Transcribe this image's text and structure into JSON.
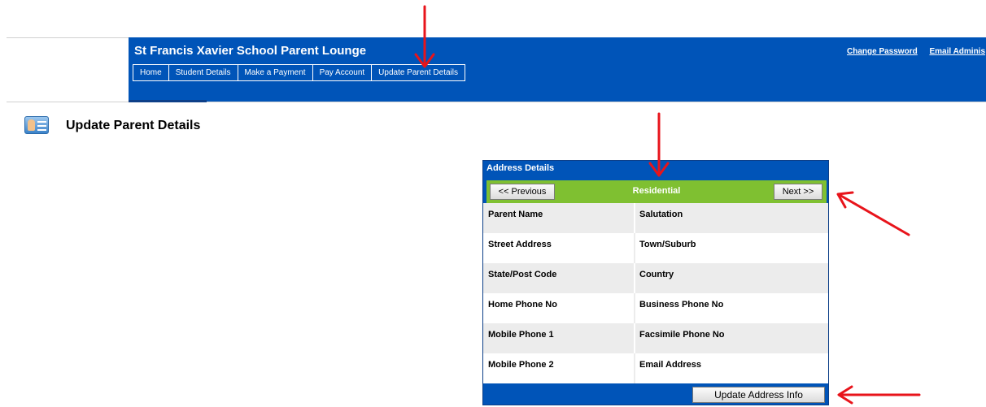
{
  "header": {
    "site_title": "St Francis Xavier School Parent Lounge",
    "links": [
      "Change Password",
      "Email Adminis"
    ],
    "nav": [
      "Home",
      "Student Details",
      "Make a Payment",
      "Pay Account",
      "Update Parent Details"
    ]
  },
  "page": {
    "title": "Update Parent Details",
    "icon": "parent-card-icon"
  },
  "panel": {
    "title": "Address Details",
    "prev_label": "<< Previous",
    "section_label": "Residential",
    "next_label": "Next >>",
    "rows": [
      [
        "Parent Name",
        "Salutation"
      ],
      [
        "Street Address",
        "Town/Suburb"
      ],
      [
        "State/Post Code",
        "Country"
      ],
      [
        "Home Phone No",
        "Business Phone No"
      ],
      [
        "Mobile Phone 1",
        "Facsimile Phone No"
      ],
      [
        "Mobile Phone 2",
        "Email Address"
      ]
    ],
    "update_label": "Update Address Info"
  },
  "colors": {
    "header_blue": "#0054b8",
    "section_green": "#7fc031",
    "annotation_red": "#e8141b"
  }
}
